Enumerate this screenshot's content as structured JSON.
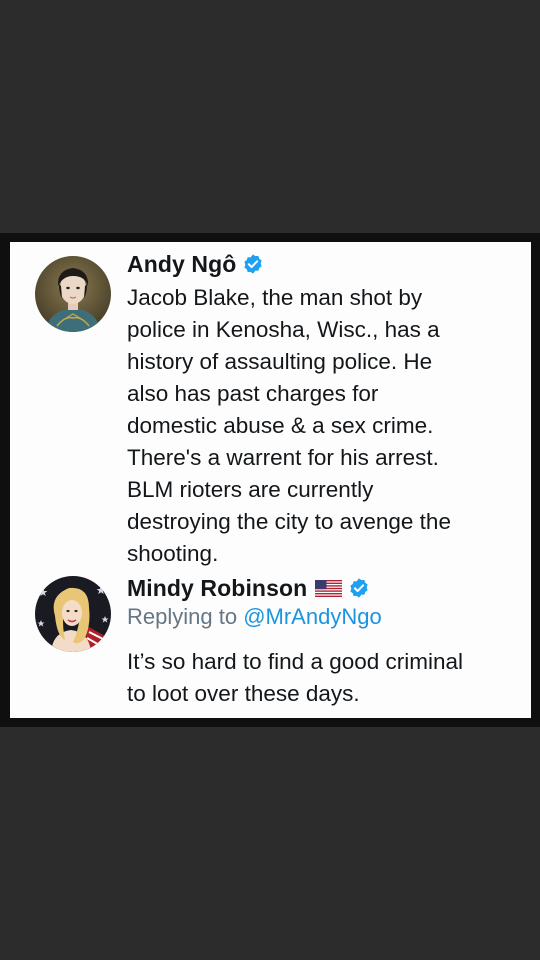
{
  "tweets": [
    {
      "author": "Andy Ngô",
      "verified": true,
      "text": "Jacob Blake, the man shot by\npolice in Kenosha, Wisc., has a\nhistory of assaulting police. He\nalso has past charges for\ndomestic abuse & a sex crime.\nThere's a warrent for his arrest.\nBLM rioters are currently\ndestroying the city to avenge the\nshooting."
    },
    {
      "author": "Mindy Robinson",
      "flag_icon": "us-flag-icon",
      "verified": true,
      "reply_prefix": "Replying to ",
      "reply_handle": "@MrAndyNgo",
      "text": "It’s so hard to find a good criminal\nto loot over these days."
    }
  ],
  "colors": {
    "background": "#2c2c2c",
    "card": "#fdfdfd",
    "text": "#14171a",
    "muted": "#657786",
    "link": "#1b95e0",
    "verified": "#1da1f2"
  }
}
